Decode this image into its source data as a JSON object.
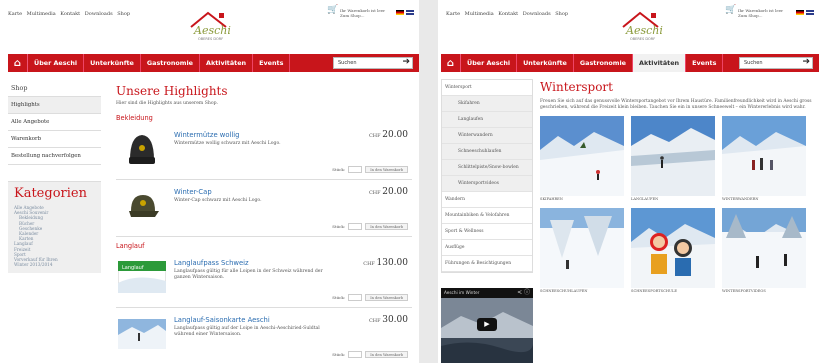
{
  "header": {
    "top_links": [
      "Karte",
      "Multimedia",
      "Kontakt",
      "Downloads",
      "Shop"
    ],
    "cart_line1": "Ihr Warenkorb ist leer",
    "cart_line2": "Zum Shop..."
  },
  "nav": {
    "items": [
      "Über Aeschi",
      "Unterkünfte",
      "Gastronomie",
      "Aktivitäten",
      "Events"
    ],
    "search_placeholder": "Suchen",
    "active_right": "Aktivitäten",
    "colors": {
      "brand_red": "#c8151b",
      "link_blue": "#2a6cb0"
    }
  },
  "left_page": {
    "sidebar": [
      "Shop",
      "Highlights",
      "Alle Angebote",
      "Warenkorb",
      "Bestellung nachverfolgen"
    ],
    "categories": {
      "title": "Kategorien",
      "items": [
        {
          "label": "Alle Angebote",
          "sub": false
        },
        {
          "label": "Aeschi Souvenir",
          "sub": false
        },
        {
          "label": "Bekleidung",
          "sub": true
        },
        {
          "label": "Bücher",
          "sub": true
        },
        {
          "label": "Geschenke",
          "sub": true
        },
        {
          "label": "Kalender",
          "sub": true
        },
        {
          "label": "Karten",
          "sub": true
        },
        {
          "label": "Langlauf",
          "sub": false
        },
        {
          "label": "Freizeit",
          "sub": false
        },
        {
          "label": "Sport",
          "sub": false
        },
        {
          "label": "Vorverkauf für Ihren",
          "sub": false
        },
        {
          "label": "Winter 2013/2014",
          "sub": false
        }
      ]
    },
    "title": "Unsere Highlights",
    "intro": "Hier sind die Highlights aus unserem Shop.",
    "sections": [
      {
        "title": "Bekleidung",
        "products": [
          {
            "name": "Wintermütze wollig",
            "desc": "Wintermütze wollig schwarz mit Aeschi Logo.",
            "currency": "CHF",
            "price": "20.00",
            "image": "beanie-icon"
          },
          {
            "name": "Winter-Cap",
            "desc": "Winter-Cap schwarz mit Aeschi Logo.",
            "currency": "CHF",
            "price": "20.00",
            "image": "cap-icon"
          }
        ]
      },
      {
        "title": "Langlauf",
        "products": [
          {
            "name": "Langlaufpass Schweiz",
            "desc": "Langlaufpass gültig für alle Loipen in der Schweiz während der ganzen Wintersaison.",
            "currency": "CHF",
            "price": "130.00",
            "image": "ski-pass-card"
          },
          {
            "name": "Langlauf-Saisonkarte Aeschi",
            "desc": "Langlaufpass gültig auf der Loipe in Aeschi-Aeschiried-Suldtal während einer Wintersaison.",
            "currency": "CHF",
            "price": "30.00",
            "image": "cross-country-photo"
          }
        ]
      }
    ],
    "qty_label": "Stück:",
    "cart_button": "In den Warenkorb"
  },
  "right_page": {
    "sidebar": [
      {
        "label": "Wintersport",
        "sub": false
      },
      {
        "label": "Skifahren",
        "sub": true
      },
      {
        "label": "Langlaufen",
        "sub": true
      },
      {
        "label": "Winterwandern",
        "sub": true
      },
      {
        "label": "Schneeschuhlaufen",
        "sub": true
      },
      {
        "label": "Schlittelpiste/Snow-bowlen",
        "sub": true
      },
      {
        "label": "Wintersportvideos",
        "sub": true
      },
      {
        "label": "Wandern",
        "sub": false
      },
      {
        "label": "Mountainbiken & Velofahren",
        "sub": false
      },
      {
        "label": "Sport & Wellness",
        "sub": false
      },
      {
        "label": "Ausflüge",
        "sub": false
      },
      {
        "label": "Führungen & Besichtigungen",
        "sub": false
      }
    ],
    "video_title": "Aeschi im Winter",
    "title": "Wintersport",
    "intro": "Freuen Sie sich auf das genussvolle Wintersportangebot vor Ihrem Haustüre. Familienfreundlichkeit wird in Aeschi gross geschrieben, während die Freizeit klein bleiben. Tauchen Sie ein in unsere Schneewelt – ein Wintererlebnis wird wahr.",
    "gallery": [
      {
        "caption": "SKIFAHREN",
        "scene": "skiing-photo"
      },
      {
        "caption": "LANGLAUFEN",
        "scene": "cross-country-photo"
      },
      {
        "caption": "WINTERWANDERN",
        "scene": "winter-hiking-photo"
      },
      {
        "caption": "SCHNEESCHUHLAUFEN",
        "scene": "snowshoe-photo"
      },
      {
        "caption": "SCHNEESPORTSCHULE",
        "scene": "ski-school-photo"
      },
      {
        "caption": "WINTERSPORTVIDEOS",
        "scene": "winter-video-photo"
      }
    ]
  }
}
